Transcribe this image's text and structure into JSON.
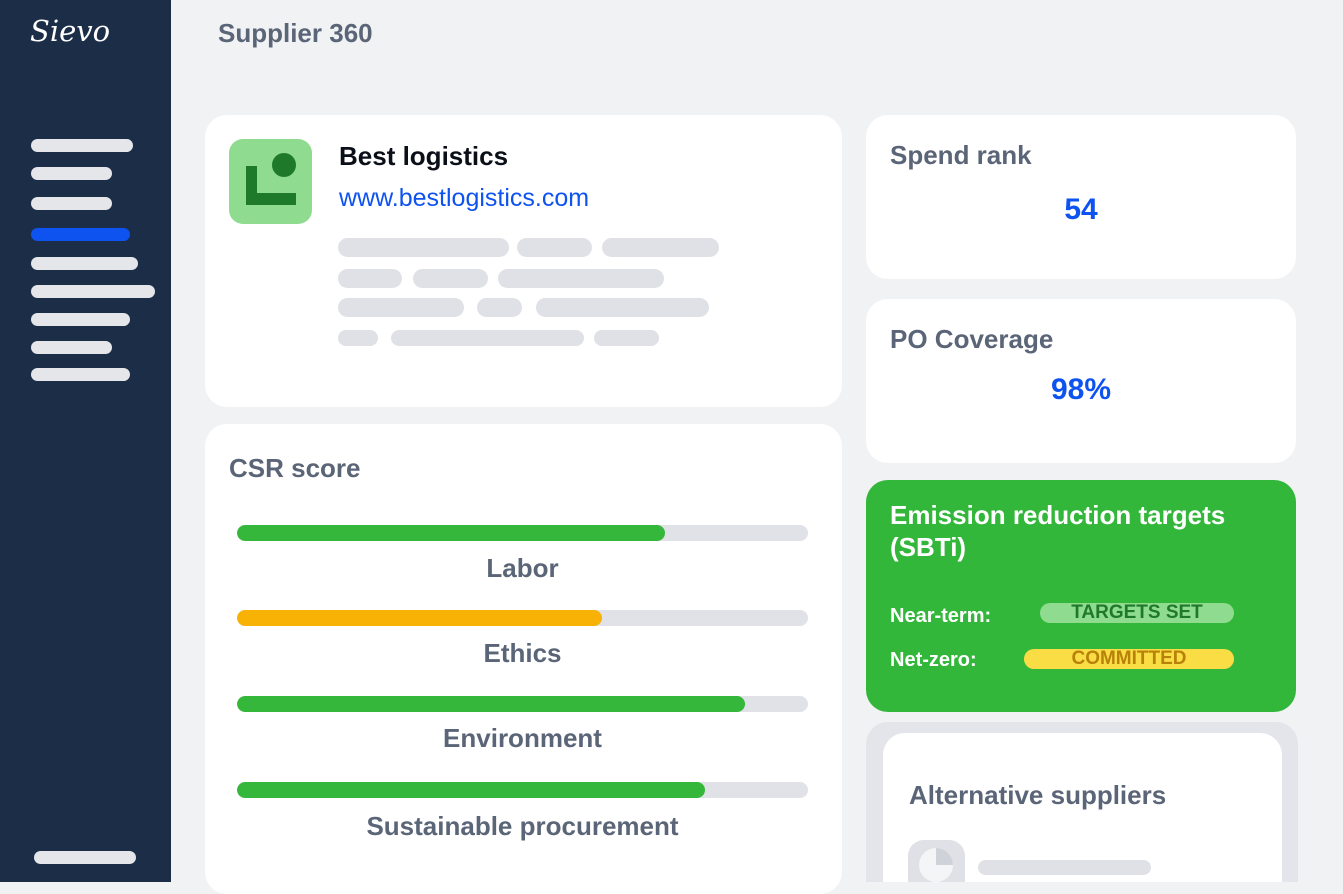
{
  "app": {
    "logo_text": "Sievo",
    "page_title": "Supplier 360"
  },
  "sidebar": {
    "active_index": 3,
    "accent_color": "#0e52f0"
  },
  "supplier": {
    "name": "Best logistics",
    "url": "www.bestlogistics.com",
    "logo_color": "#8fdb8f"
  },
  "csr": {
    "title": "CSR score",
    "items": [
      {
        "label": "Labor",
        "level": 0.75,
        "color": "#34b73a"
      },
      {
        "label": "Ethics",
        "level": 0.64,
        "color": "#f8b105"
      },
      {
        "label": "Environment",
        "level": 0.89,
        "color": "#34b73a"
      },
      {
        "label": "Sustainable procurement",
        "level": 0.82,
        "color": "#34b73a"
      }
    ]
  },
  "spend_rank": {
    "title": "Spend rank",
    "value": "54"
  },
  "po_coverage": {
    "title": "PO Coverage",
    "value": "98%"
  },
  "sbti": {
    "title": "Emission reduction targets (SBTi)",
    "background_color": "#33b73a",
    "near_term": {
      "label": "Near-term:",
      "status": "TARGETS SET",
      "pill_color": "#8fdb8f",
      "text_color": "#1e7a2a"
    },
    "net_zero": {
      "label": "Net-zero:",
      "status": "COMMITTED",
      "pill_color": "#fadd45",
      "text_color": "#b8820a"
    }
  },
  "alternatives": {
    "title": "Alternative suppliers"
  }
}
